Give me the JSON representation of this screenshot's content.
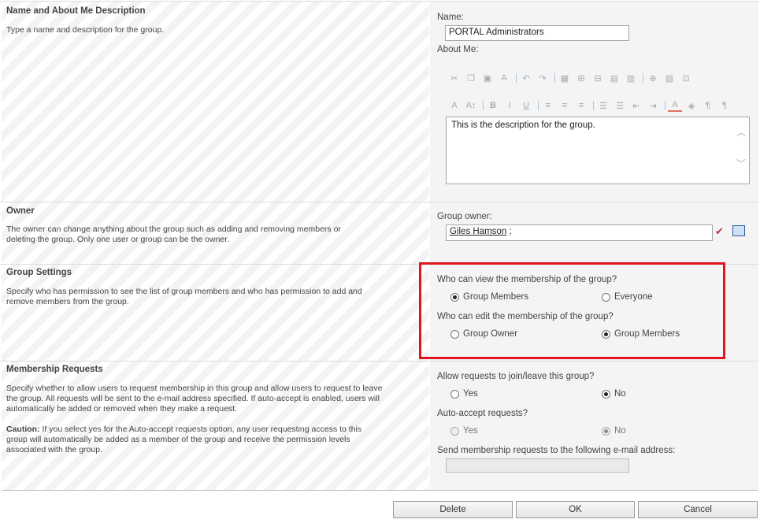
{
  "name_section": {
    "title": "Name and About Me Description",
    "description": "Type a name and description for the group.",
    "name_label": "Name:",
    "name_value": "PORTAL Administrators",
    "about_label": "About Me:",
    "about_value": "This is the description for the group."
  },
  "owner_section": {
    "title": "Owner",
    "description": "The owner can change anything about the group such as adding and removing members or deleting the group. Only one user or group can be the owner.",
    "owner_label": "Group owner:",
    "owner_name": "Giles Hamson",
    "owner_suffix": " ;"
  },
  "group_settings": {
    "title": "Group Settings",
    "description": "Specify who has permission to see the list of group members and who has permission to add and remove members from the group.",
    "view_question": "Who can view the membership of the group?",
    "view_options": [
      "Group Members",
      "Everyone"
    ],
    "view_selected": "Group Members",
    "edit_question": "Who can edit the membership of the group?",
    "edit_options": [
      "Group Owner",
      "Group Members"
    ],
    "edit_selected": "Group Members"
  },
  "membership_requests": {
    "title": "Membership Requests",
    "description": "Specify whether to allow users to request membership in this group and allow users to request to leave the group. All requests will be sent to the e-mail address specified. If auto-accept is enabled, users will automatically be added or removed when they make a request.",
    "caution_label": "Caution:",
    "caution_text": " If you select yes for the Auto-accept requests option, any user requesting access to this group will automatically be added as a member of the group and receive the permission levels associated with the group.",
    "allow_question": "Allow requests to join/leave this group?",
    "allow_options": [
      "Yes",
      "No"
    ],
    "allow_selected": "No",
    "auto_question": "Auto-accept requests?",
    "auto_options": [
      "Yes",
      "No"
    ],
    "auto_selected": "No",
    "email_label": "Send membership requests to the following e-mail address:",
    "email_value": ""
  },
  "buttons": {
    "delete": "Delete",
    "ok": "OK",
    "cancel": "Cancel"
  },
  "highlight_color": "#e0141e"
}
